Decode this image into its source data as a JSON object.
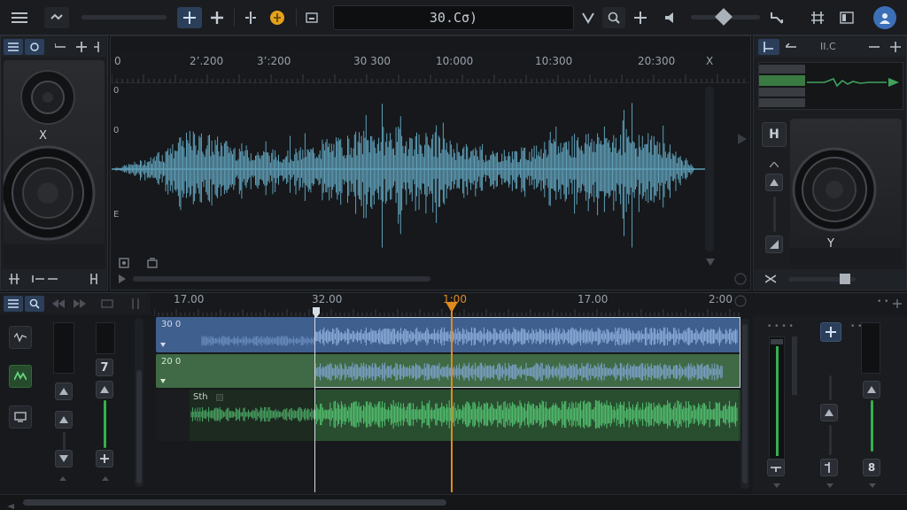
{
  "toolbar": {
    "timecode": "30.Cσ)",
    "colors": {
      "accent_blue": "#2c3f5a",
      "record_orange": "#e4a21d",
      "avatar_blue": "#3d6fb8"
    },
    "icons": [
      "menu-icon",
      "loop-icon",
      "cursor-tool-icon",
      "add-icon",
      "split-icon",
      "record-icon",
      "monitor-icon",
      "trim-icon",
      "zoom-icon",
      "add-marker-icon",
      "volume-icon",
      "curve-icon",
      "grid-icon",
      "window-icon",
      "user-icon"
    ],
    "volume_level": 0.5
  },
  "editor": {
    "ruler_labels": [
      "0",
      "2’.200",
      "3’:200",
      "30 300",
      "10:000",
      "10:300",
      "20:300"
    ],
    "ruler_close": "X",
    "vertical_labels": [
      "0",
      "0",
      "E"
    ],
    "waveform_color": "#5f9fb8"
  },
  "left_speaker": {
    "label": "X"
  },
  "right_panel": {
    "tab_label": "II.C",
    "hp_label": "H",
    "speaker_label": "Y"
  },
  "timeline": {
    "ruler_labels": [
      "17.00",
      "32.00",
      "1:00",
      "17.00",
      "2:00"
    ],
    "playhead_color": "#e08a1e",
    "tracks": [
      {
        "name": "30 0",
        "color": "#3f5f8f"
      },
      {
        "name": "20 0",
        "color": "#3f6a45"
      },
      {
        "name": "Sth",
        "color": "#2f5a35"
      }
    ]
  },
  "mixer_left": {
    "channel_value": "7"
  },
  "mixer_right": {
    "channel_value": "8"
  }
}
